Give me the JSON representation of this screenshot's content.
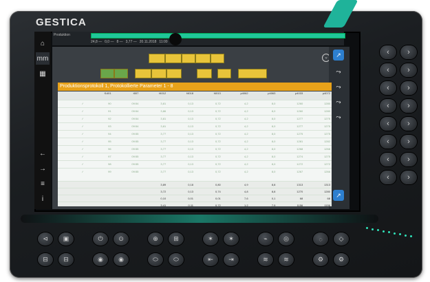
{
  "device": {
    "brand": "GESTICA",
    "accent": "#1fb39a"
  },
  "topbar": {
    "left_label": "Produktion",
    "status_items": [
      "24,8 —",
      "0,0 —",
      "8 —",
      "3,77 —",
      "20.11.2018",
      "11:00"
    ]
  },
  "panel": {
    "title": "Produktionsprotokoll 1, Protokollierte Parameter 1 - 8",
    "toolbar_top": [
      "",
      "",
      "",
      "",
      ""
    ],
    "toolbar_mid": [
      "",
      "",
      "",
      "",
      "",
      "",
      "",
      ""
    ]
  },
  "table": {
    "headers": [
      "f1401",
      "t007",
      "f4012",
      "f4018",
      "f4013",
      "p4062",
      "p4063",
      "p4033",
      "p4072"
    ],
    "units": [
      "",
      "f.secs",
      "s",
      "s",
      "s",
      "mm",
      "mm",
      "bar",
      "bar"
    ],
    "rows": [
      [
        "90",
        "09:54",
        "3,81",
        "0,13",
        "0,72",
        "4,2",
        "8,0",
        "1260",
        "1280"
      ],
      [
        "91",
        "09:54",
        "3,86",
        "0,13",
        "0,72",
        "4,2",
        "8,0",
        "1260",
        "1280"
      ],
      [
        "92",
        "09:54",
        "3,81",
        "0,13",
        "0,72",
        "4,2",
        "8,0",
        "1277",
        "1275"
      ],
      [
        "93",
        "09:54",
        "3,81",
        "0,13",
        "0,72",
        "4,2",
        "8,0",
        "1277",
        "1275"
      ],
      [
        "94",
        "09:55",
        "3,77",
        "0,13",
        "0,72",
        "4,2",
        "8,0",
        "1275",
        "1275"
      ],
      [
        "95",
        "09:55",
        "3,77",
        "0,13",
        "0,72",
        "4,2",
        "8,0",
        "1281",
        "1282"
      ],
      [
        "96",
        "09:55",
        "3,77",
        "0,13",
        "0,72",
        "4,2",
        "8,0",
        "1268",
        "1268"
      ],
      [
        "97",
        "09:55",
        "3,77",
        "0,13",
        "0,72",
        "4,2",
        "8,0",
        "1274",
        "1275"
      ],
      [
        "98",
        "09:55",
        "3,77",
        "0,13",
        "0,72",
        "4,2",
        "8,0",
        "1272",
        "1272"
      ],
      [
        "99",
        "09:55",
        "3,77",
        "0,13",
        "0,72",
        "4,2",
        "8,0",
        "1267",
        "1266"
      ]
    ],
    "stats": [
      [
        "",
        "",
        "3,89",
        "0,18",
        "0,80",
        "4,9",
        "8,8",
        "1313",
        "1313"
      ],
      [
        "",
        "",
        "3,72",
        "0,13",
        "0,74",
        "4,8",
        "8,8",
        "1270",
        "1280"
      ],
      [
        "",
        "",
        "0,10",
        "0,01",
        "0,01",
        "7,6",
        "0,1",
        "68",
        "68"
      ],
      [
        "",
        "",
        "3,41",
        "0,11",
        "0,72",
        "1,2",
        "7,9",
        "1156",
        "1156"
      ]
    ]
  },
  "progress_fraction": 1.0
}
